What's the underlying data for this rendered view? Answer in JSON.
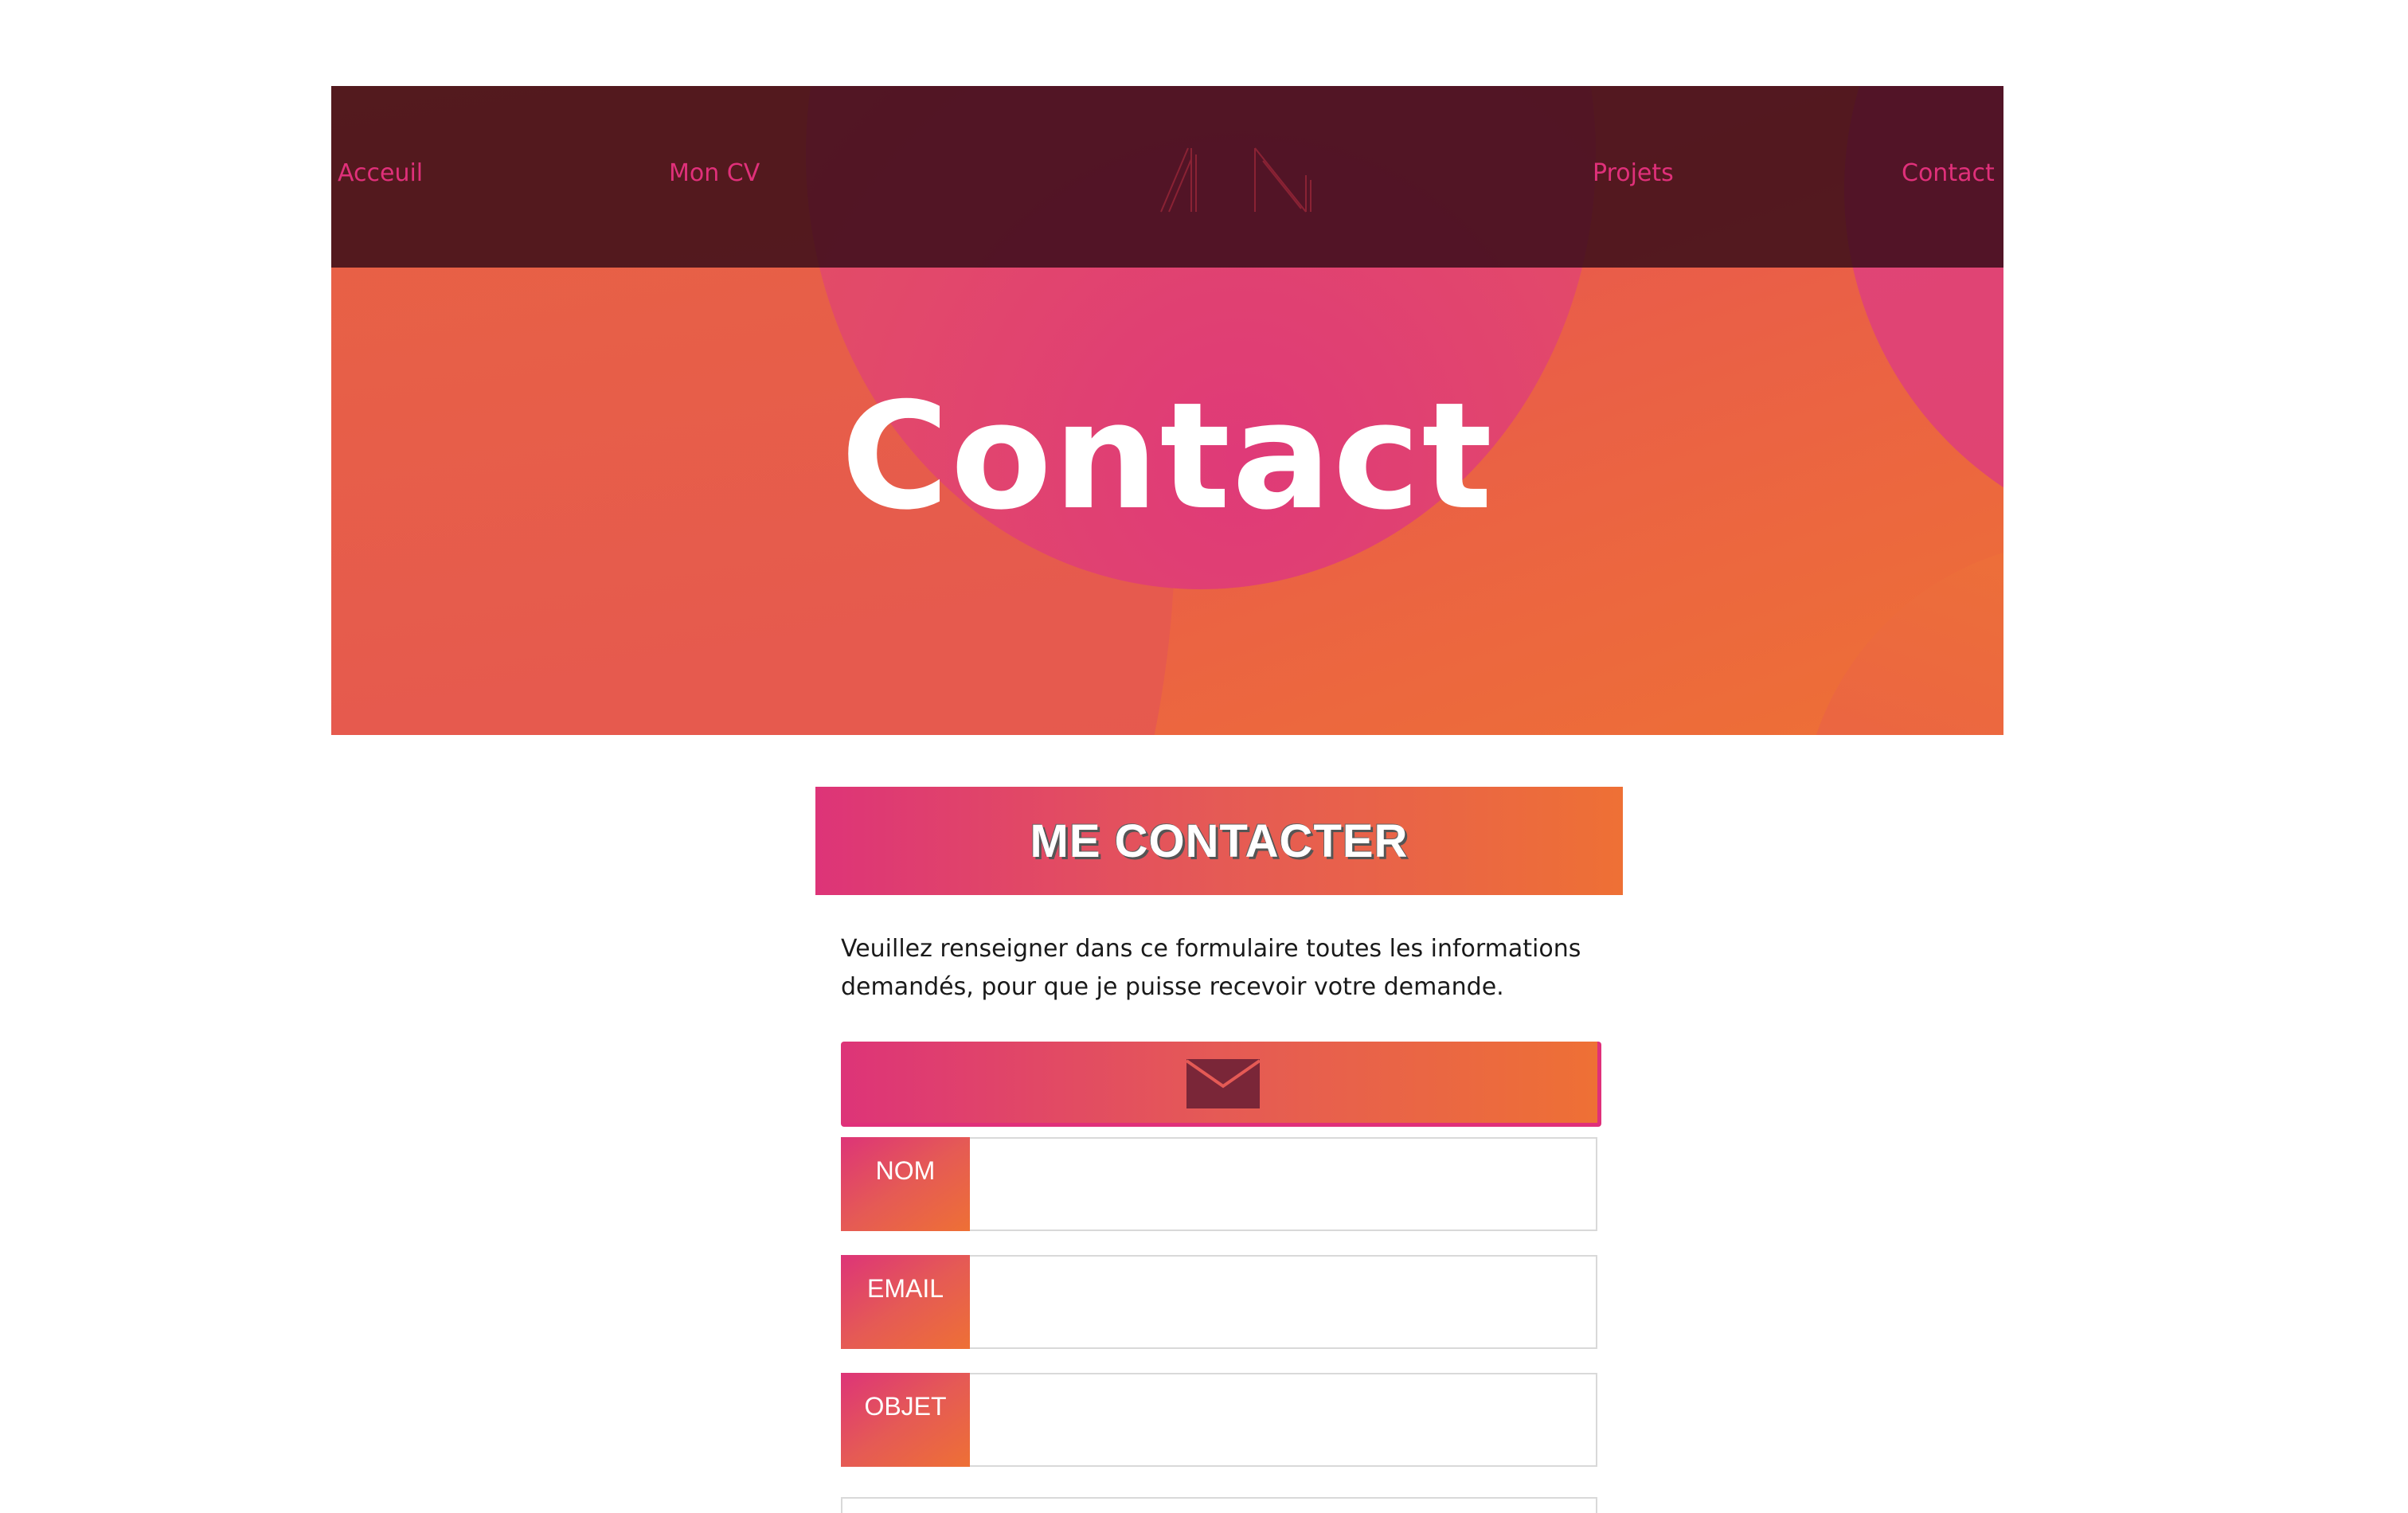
{
  "nav": {
    "links": [
      "Acceuil",
      "Mon CV",
      "Projets",
      "Contact"
    ],
    "logo_icon": "initials-logo-icon"
  },
  "hero": {
    "title": "Contact"
  },
  "contact": {
    "banner_title": "ME CONTACTER",
    "intro_text": "Veuillez renseigner dans ce formulaire toutes les informations demandés, pour que je puisse recevoir votre demande.",
    "mail_icon": "envelope-icon",
    "fields": [
      {
        "label": "NOM",
        "value": ""
      },
      {
        "label": "EMAIL",
        "value": ""
      },
      {
        "label": "OBJET",
        "value": ""
      }
    ]
  },
  "colors": {
    "accent_pink": "#e0307a",
    "accent_orange": "#ee7035",
    "nav_bg": "#320a16",
    "envelope": "#7a2638"
  }
}
